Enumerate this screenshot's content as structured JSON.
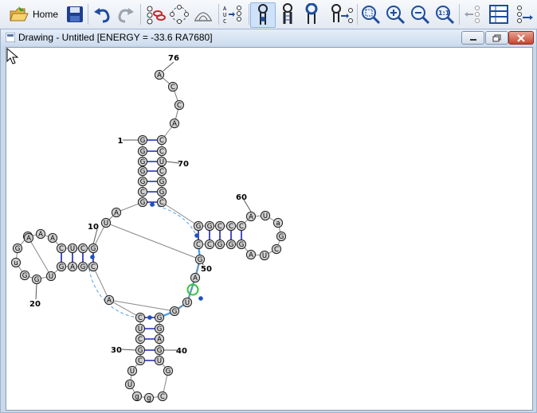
{
  "toolbar": {
    "home_label": "Home",
    "buttons": [
      "open-folder-icon",
      "save-icon",
      "undo-icon",
      "redo-icon",
      "link-bases-icon",
      "circular-layout-icon",
      "arc-layout-icon",
      "sequence-edit-icon",
      "hairpin-select-icon",
      "helix-select-icon",
      "loop-select-icon",
      "loop-export-icon",
      "zoom-fit-icon",
      "zoom-in-icon",
      "zoom-out-icon",
      "zoom-reset-icon",
      "back-icon",
      "table-icon",
      "export-icon"
    ]
  },
  "window": {
    "title": "Drawing - Untitled [ENERGY = -33.6  RA7680]"
  },
  "rna": {
    "labels": [
      {
        "text": "76"
      },
      {
        "text": "1"
      },
      {
        "text": "70"
      },
      {
        "text": "60"
      },
      {
        "text": "10"
      },
      {
        "text": "50"
      },
      {
        "text": "20"
      },
      {
        "text": "30"
      },
      {
        "text": "40"
      }
    ],
    "nucleotides": {
      "acceptor_5": [
        "G",
        "G",
        "G",
        "G",
        "G",
        "C",
        "G"
      ],
      "acceptor_3": [
        "C",
        "C",
        "U",
        "C",
        "G",
        "G",
        "C"
      ],
      "tail": [
        "A",
        "C",
        "C",
        "A"
      ],
      "tail_top": "A",
      "d_stem_top": [
        "C",
        "U",
        "C",
        "G"
      ],
      "d_stem_bottom": [
        "G",
        "A",
        "G",
        "C"
      ],
      "d_loop": [
        "A",
        "A",
        "G",
        "G",
        "u",
        "G",
        "G",
        "U",
        "A"
      ],
      "t_stem_top": [
        "G",
        "G",
        "C",
        "C",
        "C"
      ],
      "t_stem_bottom": [
        "C",
        "C",
        "G",
        "G",
        "G"
      ],
      "t_loop": [
        "A",
        "U",
        "a",
        "G",
        "C",
        "U",
        "A"
      ],
      "anticodon_left": [
        "C",
        "U",
        "C",
        "G",
        "C"
      ],
      "anticodon_right": [
        "G",
        "A",
        "G",
        "U",
        "G"
      ],
      "anticodon_loop": [
        "U",
        "U",
        "g",
        "g",
        "C",
        "G"
      ],
      "connector": [
        "A",
        "U",
        "G",
        "A",
        "U",
        "G",
        "A"
      ]
    }
  }
}
